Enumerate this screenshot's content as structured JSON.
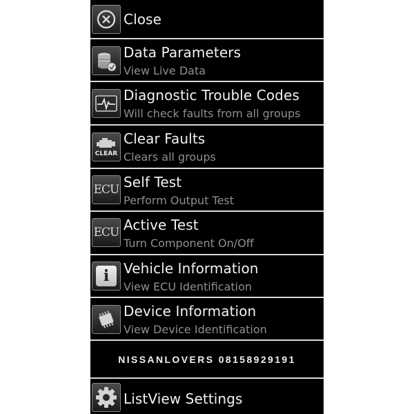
{
  "menu": {
    "close": {
      "title": "Close",
      "icon": "close-circle-icon"
    },
    "items": [
      {
        "title": "Data Parameters",
        "subtitle": "View Live Data",
        "icon": "database-icon"
      },
      {
        "title": "Diagnostic Trouble Codes",
        "subtitle": "Will check faults from all groups",
        "icon": "ecg-monitor-icon"
      },
      {
        "title": "Clear Faults",
        "subtitle": "Clears all groups",
        "icon": "engine-clear-icon",
        "icon_text": "CLEAR"
      },
      {
        "title": "Self Test",
        "subtitle": "Perform Output Test",
        "icon": "ecu-icon",
        "icon_text": "ECU"
      },
      {
        "title": "Active Test",
        "subtitle": "Turn Component On/Off",
        "icon": "ecu-icon",
        "icon_text": "ECU"
      },
      {
        "title": "Vehicle Information",
        "subtitle": "View ECU Identification",
        "icon": "info-icon",
        "icon_text": "i"
      },
      {
        "title": "Device Information",
        "subtitle": "View Device Identification",
        "icon": "chip-icon"
      }
    ],
    "banner": "NISSANLOVERS 08158929191",
    "settings": {
      "title": "ListView Settings",
      "icon": "gear-icon"
    }
  },
  "colors": {
    "background": "#000000",
    "title_text": "#f2f2f2",
    "subtitle_text": "#8f8f8f",
    "separator": "#d9d9d9"
  }
}
